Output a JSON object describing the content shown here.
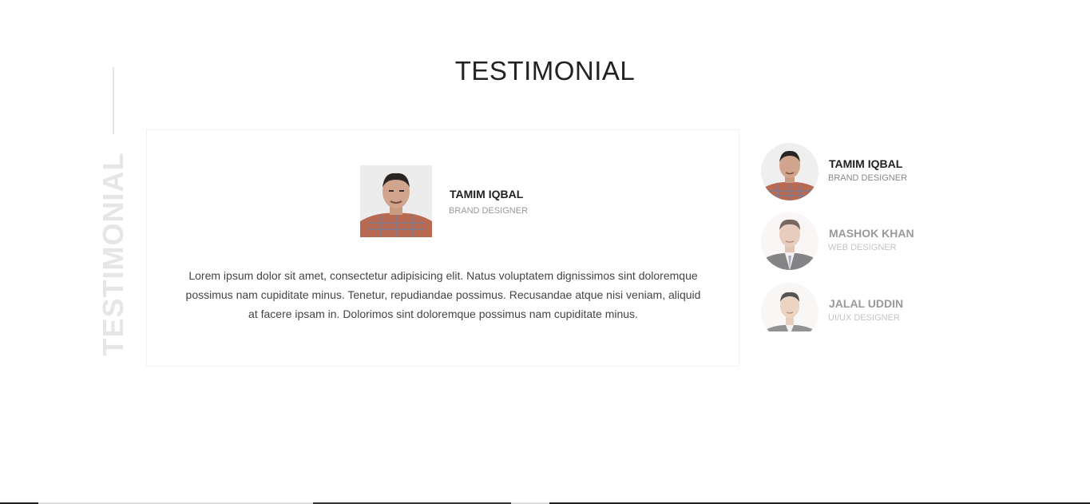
{
  "section": {
    "title": "TESTIMONIAL",
    "side_label": "TESTIMONIAL"
  },
  "featured": {
    "name": "TAMIM IQBAL",
    "role": "BRAND DESIGNER",
    "quote": "Lorem ipsum dolor sit amet, consectetur adipisicing elit. Natus voluptatem dignissimos sint doloremque possimus nam cupiditate minus. Tenetur, repudiandae possimus. Recusandae atque nisi veniam, aliquid at facere ipsam in. Dolorimos sint doloremque possimus nam cupiditate minus."
  },
  "people": [
    {
      "name": "TAMIM IQBAL",
      "role": "BRAND DESIGNER",
      "active": true
    },
    {
      "name": "MASHOK KHAN",
      "role": "WEB DESIGNER",
      "active": false
    },
    {
      "name": "JALAL UDDIN",
      "role": "UI/UX DESIGNER",
      "active": false
    }
  ],
  "colors": {
    "name_active": "#222222",
    "role_active": "#888888",
    "name_inactive": "#999999",
    "role_inactive": "#c4c4c4"
  }
}
